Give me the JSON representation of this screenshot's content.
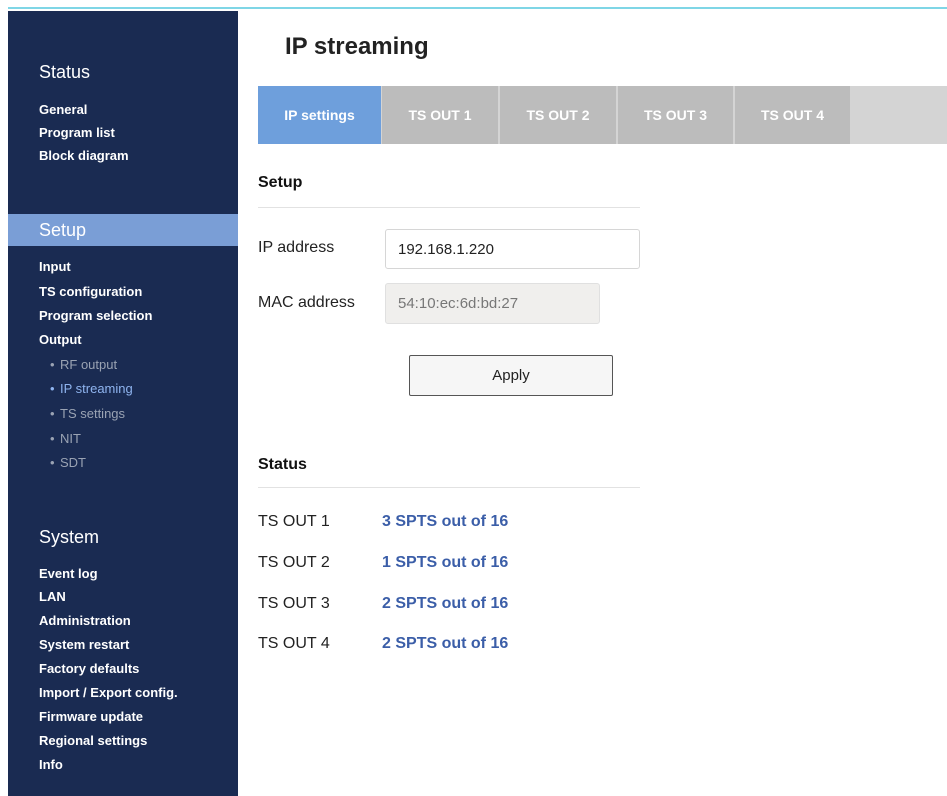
{
  "sidebar": {
    "status": {
      "title": "Status",
      "items": [
        "General",
        "Program list",
        "Block diagram"
      ]
    },
    "setup": {
      "title": "Setup",
      "items": [
        "Input",
        "TS configuration",
        "Program selection",
        "Output"
      ],
      "output_sub": [
        "RF output",
        "IP streaming",
        "TS settings",
        "NIT",
        "SDT"
      ]
    },
    "system": {
      "title": "System",
      "items": [
        "Event log",
        "LAN",
        "Administration",
        "System restart",
        "Factory defaults",
        "Import / Export config.",
        "Firmware update",
        "Regional settings",
        "Info"
      ]
    }
  },
  "page": {
    "title": "IP streaming",
    "tabs": [
      "IP settings",
      "TS OUT 1",
      "TS OUT 2",
      "TS OUT 3",
      "TS OUT 4"
    ]
  },
  "setup": {
    "heading": "Setup",
    "ip_label": "IP address",
    "ip_value": "192.168.1.220",
    "mac_label": "MAC address",
    "mac_value": "54:10:ec:6d:bd:27",
    "apply_label": "Apply"
  },
  "status": {
    "heading": "Status",
    "rows": [
      {
        "label": "TS OUT 1",
        "value": "3 SPTS out of 16"
      },
      {
        "label": "TS OUT 2",
        "value": "1 SPTS out of 16"
      },
      {
        "label": "TS OUT 3",
        "value": "2 SPTS out of 16"
      },
      {
        "label": "TS OUT 4",
        "value": "2 SPTS out of 16"
      }
    ]
  },
  "colors": {
    "sidebar_bg": "#1a2b52",
    "active_accent": "#7a9ed6",
    "tab_active": "#6e9fdc",
    "tab_inactive": "#bcbcbc",
    "status_value": "#3b5ea8"
  }
}
